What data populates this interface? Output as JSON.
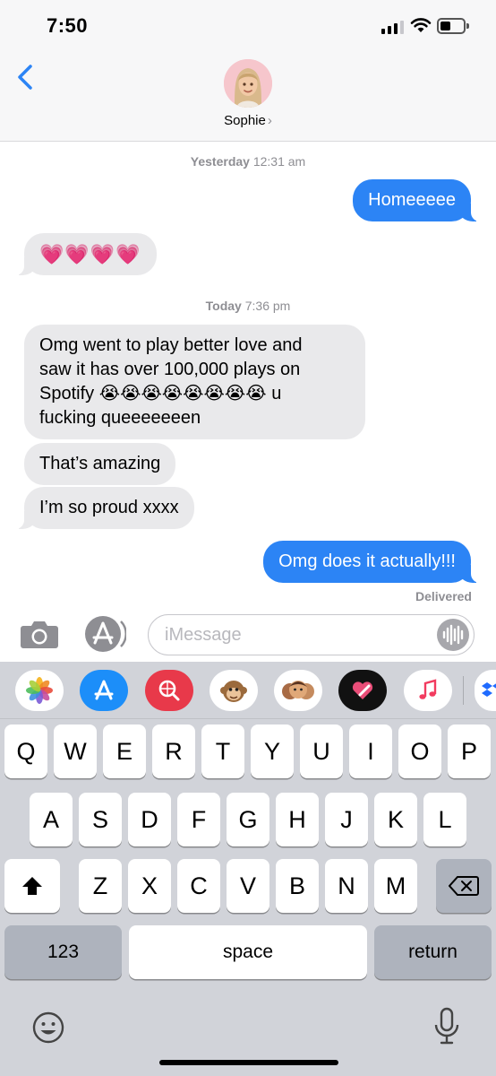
{
  "status": {
    "time": "7:50"
  },
  "header": {
    "contact_name": "Sophie",
    "chevron": "›"
  },
  "conversation": {
    "groups": [
      {
        "day": "Yesterday",
        "time": "12:31 am"
      },
      {
        "day": "Today",
        "time": "7:36 pm"
      }
    ],
    "messages": [
      {
        "direction": "outgoing",
        "text": "Homeeeee"
      },
      {
        "direction": "incoming",
        "text": "💗💗💗💗"
      },
      {
        "direction": "incoming",
        "lines": [
          "Omg went to play better love and",
          "saw it has over 100,000 plays on",
          "Spotify 😭😭😭😭😭😭😭😭 u",
          "fucking queeeeeeen"
        ]
      },
      {
        "direction": "incoming",
        "text": "That’s amazing"
      },
      {
        "direction": "incoming",
        "text": "I’m so proud xxxx"
      },
      {
        "direction": "outgoing",
        "text": "Omg does it actually!!!"
      }
    ],
    "delivered": "Delivered"
  },
  "input": {
    "placeholder": "iMessage"
  },
  "app_drawer": [
    "photos-icon",
    "app-store-icon",
    "web-search-icon",
    "animoji-icon",
    "memoji-stickers-icon",
    "digital-touch-icon",
    "music-icon",
    "dropbox-icon"
  ],
  "keyboard": {
    "row1": [
      "Q",
      "W",
      "E",
      "R",
      "T",
      "Y",
      "U",
      "I",
      "O",
      "P"
    ],
    "row2": [
      "A",
      "S",
      "D",
      "F",
      "G",
      "H",
      "J",
      "K",
      "L"
    ],
    "row3": [
      "Z",
      "X",
      "C",
      "V",
      "B",
      "N",
      "M"
    ],
    "numbers_label": "123",
    "space_label": "space",
    "return_label": "return"
  },
  "colors": {
    "outgoing_bubble": "#2c84f5",
    "incoming_bubble": "#e9e9eb",
    "accent": "#2c84f5"
  }
}
